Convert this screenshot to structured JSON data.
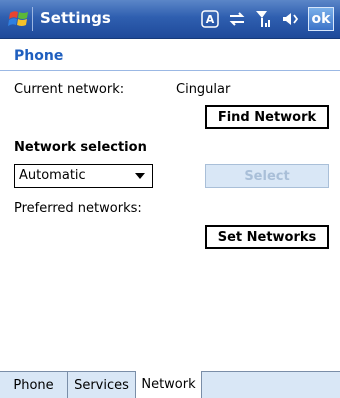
{
  "titlebar": {
    "title": "Settings",
    "ok_label": "ok",
    "icons": [
      "windows-start-icon",
      "input-method-icon",
      "connectivity-icon",
      "signal-strength-icon",
      "volume-icon"
    ]
  },
  "section": {
    "title": "Phone"
  },
  "current_network": {
    "label": "Current network:",
    "value": "Cingular"
  },
  "buttons": {
    "find_network": "Find Network",
    "select": "Select",
    "set_networks": "Set Networks"
  },
  "network_selection": {
    "heading": "Network selection",
    "selected": "Automatic"
  },
  "preferred_networks_label": "Preferred networks:",
  "tabs": [
    {
      "label": "Phone"
    },
    {
      "label": "Services"
    },
    {
      "label": "Network",
      "active": true
    }
  ],
  "colors": {
    "title_bar": "#2f5fb0",
    "section_title": "#1f5fbf",
    "tab_inactive": "#d9e7f6"
  }
}
